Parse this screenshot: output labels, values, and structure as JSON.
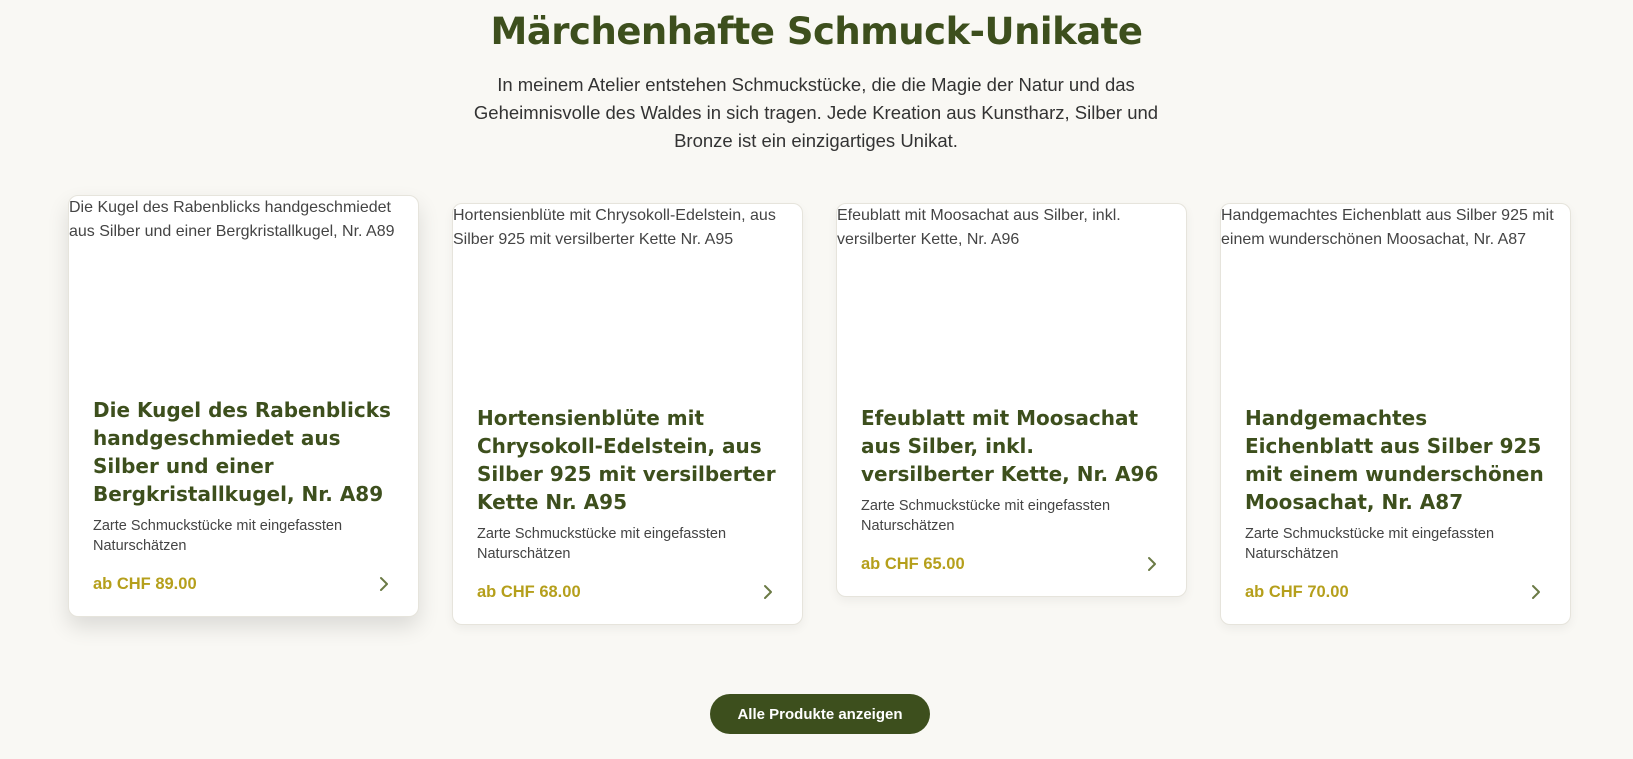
{
  "section": {
    "title": "Märchenhafte Schmuck-Unikate",
    "intro": "In meinem Atelier entstehen Schmuckstücke, die die Magie der Natur und das Geheimnisvolle des Waldes in sich tragen. Jede Kreation aus Kunstharz, Silber und Bronze ist ein einzigartiges Unikat."
  },
  "products": [
    {
      "image_alt": "Die Kugel des Rabenblicks handgeschmiedet aus Silber und einer Bergkristallkugel, Nr. A89",
      "title": "Die Kugel des Rabenblicks handgeschmiedet aus Silber und einer Bergkristallkugel, Nr. A89",
      "description": "Zarte Schmuckstücke mit eingefassten Naturschätzen",
      "price": "ab CHF 89.00"
    },
    {
      "image_alt": "Hortensienblüte mit Chrysokoll-Edelstein, aus Silber 925 mit versilberter Kette Nr. A95",
      "title": "Hortensienblüte mit Chrysokoll-Edelstein, aus Silber 925 mit versilberter Kette Nr. A95",
      "description": "Zarte Schmuckstücke mit eingefassten Naturschätzen",
      "price": "ab CHF 68.00"
    },
    {
      "image_alt": "Efeublatt mit Moosachat aus Silber, inkl. versilberter Kette, Nr. A96",
      "title": "Efeublatt mit Moosachat aus Silber, inkl. versilberter Kette, Nr. A96",
      "description": "Zarte Schmuckstücke mit eingefassten Naturschätzen",
      "price": "ab CHF 65.00"
    },
    {
      "image_alt": "Handgemachtes Eichenblatt aus Silber 925 mit einem wunderschönen Moosachat, Nr. A87",
      "title": "Handgemachtes Eichenblatt aus Silber 925 mit einem wunderschönen Moosachat, Nr. A87",
      "description": "Zarte Schmuckstücke mit eingefassten Naturschätzen",
      "price": "ab CHF 70.00"
    }
  ],
  "cta": {
    "label": "Alle Produkte anzeigen"
  },
  "colors": {
    "accent": "#3d4f1d",
    "price": "#b59f1b",
    "background": "#f9f8f4"
  },
  "icons": {
    "card_arrow": "chevron-right-icon"
  }
}
